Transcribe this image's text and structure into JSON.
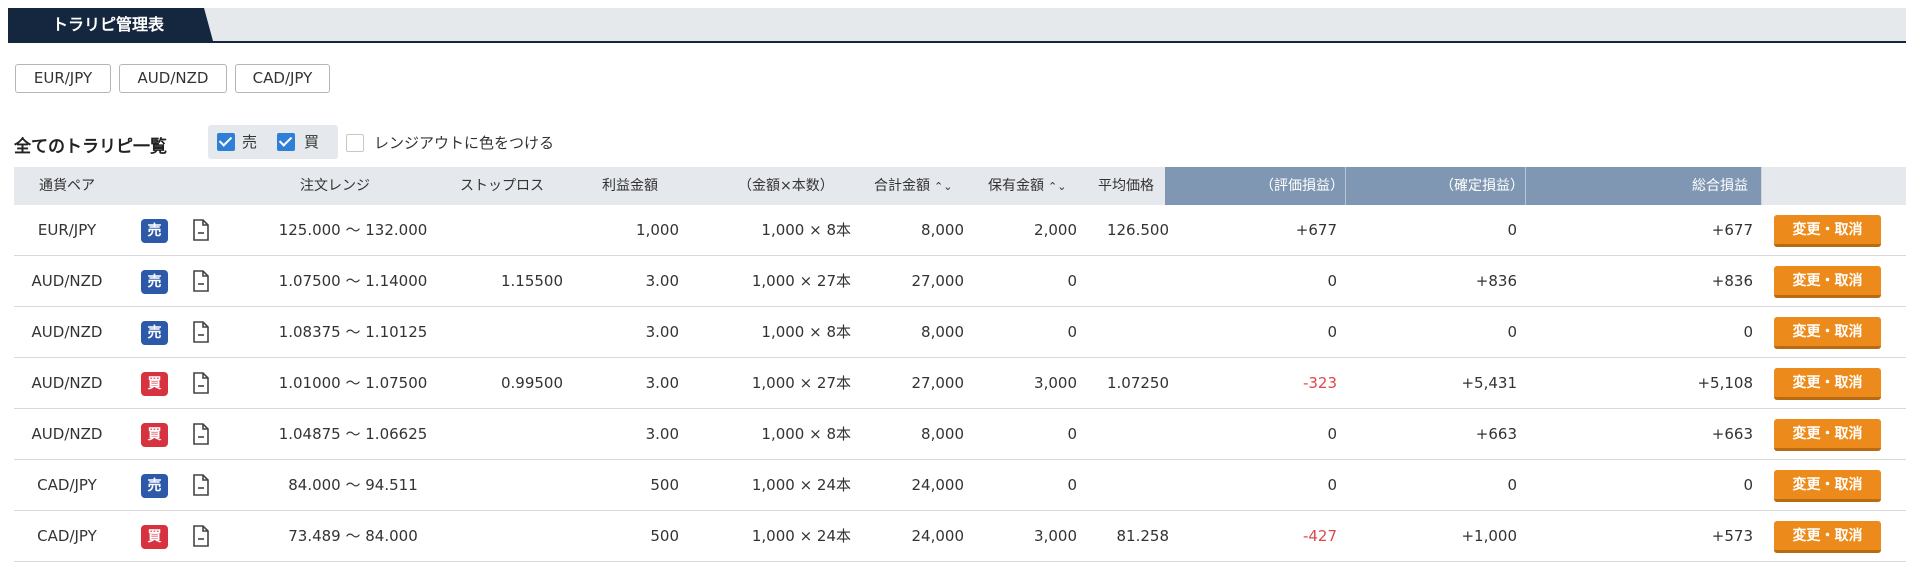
{
  "tab": {
    "label": "トラリピ管理表"
  },
  "pair_buttons": [
    "EUR/JPY",
    "AUD/NZD",
    "CAD/JPY"
  ],
  "list_title": "全てのトラリピ一覧",
  "filters": {
    "sell": {
      "label": "売",
      "checked": true
    },
    "buy": {
      "label": "買",
      "checked": true
    },
    "range_out": {
      "label": "レンジアウトに色をつける",
      "checked": false
    }
  },
  "columns": {
    "pair": "通貨ペア",
    "range": "注文レンジ",
    "stop": "ストップロス",
    "profit": "利益金額",
    "amount": "（金額×本数）",
    "total": "合計金額",
    "holding": "保有金額",
    "avg": "平均価格",
    "unrealized": "（評価損益）",
    "realized": "（確定損益）",
    "net": "総合損益"
  },
  "rows": [
    {
      "pair": "EUR/JPY",
      "side": "売",
      "side_type": "sell",
      "range": "125.000 〜 132.000",
      "stop": "",
      "profit": "1,000",
      "amount": "1,000 × 8本",
      "total": "8,000",
      "holding": "2,000",
      "avg": "126.500",
      "unrealized": "+677",
      "unrealized_neg": false,
      "realized": "0",
      "net": "+677",
      "action": "変更・取消"
    },
    {
      "pair": "AUD/NZD",
      "side": "売",
      "side_type": "sell",
      "range": "1.07500 〜 1.14000",
      "stop": "1.15500",
      "profit": "3.00",
      "amount": "1,000 × 27本",
      "total": "27,000",
      "holding": "0",
      "avg": "",
      "unrealized": "0",
      "unrealized_neg": false,
      "realized": "+836",
      "net": "+836",
      "action": "変更・取消"
    },
    {
      "pair": "AUD/NZD",
      "side": "売",
      "side_type": "sell",
      "range": "1.08375 〜 1.10125",
      "stop": "",
      "profit": "3.00",
      "amount": "1,000 × 8本",
      "total": "8,000",
      "holding": "0",
      "avg": "",
      "unrealized": "0",
      "unrealized_neg": false,
      "realized": "0",
      "net": "0",
      "action": "変更・取消"
    },
    {
      "pair": "AUD/NZD",
      "side": "買",
      "side_type": "buy",
      "range": "1.01000 〜 1.07500",
      "stop": "0.99500",
      "profit": "3.00",
      "amount": "1,000 × 27本",
      "total": "27,000",
      "holding": "3,000",
      "avg": "1.07250",
      "unrealized": "-323",
      "unrealized_neg": true,
      "realized": "+5,431",
      "net": "+5,108",
      "action": "変更・取消"
    },
    {
      "pair": "AUD/NZD",
      "side": "買",
      "side_type": "buy",
      "range": "1.04875 〜 1.06625",
      "stop": "",
      "profit": "3.00",
      "amount": "1,000 × 8本",
      "total": "8,000",
      "holding": "0",
      "avg": "",
      "unrealized": "0",
      "unrealized_neg": false,
      "realized": "+663",
      "net": "+663",
      "action": "変更・取消"
    },
    {
      "pair": "CAD/JPY",
      "side": "売",
      "side_type": "sell",
      "range": "84.000 〜 94.511",
      "stop": "",
      "profit": "500",
      "amount": "1,000 × 24本",
      "total": "24,000",
      "holding": "0",
      "avg": "",
      "unrealized": "0",
      "unrealized_neg": false,
      "realized": "0",
      "net": "0",
      "action": "変更・取消"
    },
    {
      "pair": "CAD/JPY",
      "side": "買",
      "side_type": "buy",
      "range": "73.489 〜 84.000",
      "stop": "",
      "profit": "500",
      "amount": "1,000 × 24本",
      "total": "24,000",
      "holding": "3,000",
      "avg": "81.258",
      "unrealized": "-427",
      "unrealized_neg": true,
      "realized": "+1,000",
      "net": "+573",
      "action": "変更・取消"
    }
  ],
  "colors": {
    "tab_bg": "#15263f",
    "header_highlight": "#7f97b2",
    "sell_badge": "#2c5aa8",
    "buy_badge": "#d7323f",
    "negative": "#e0474c",
    "action_button": "#ec8b1b"
  },
  "icons": {
    "sort": "sort-updown-icon",
    "document": "document-icon",
    "checkbox": "checkmark-icon"
  }
}
